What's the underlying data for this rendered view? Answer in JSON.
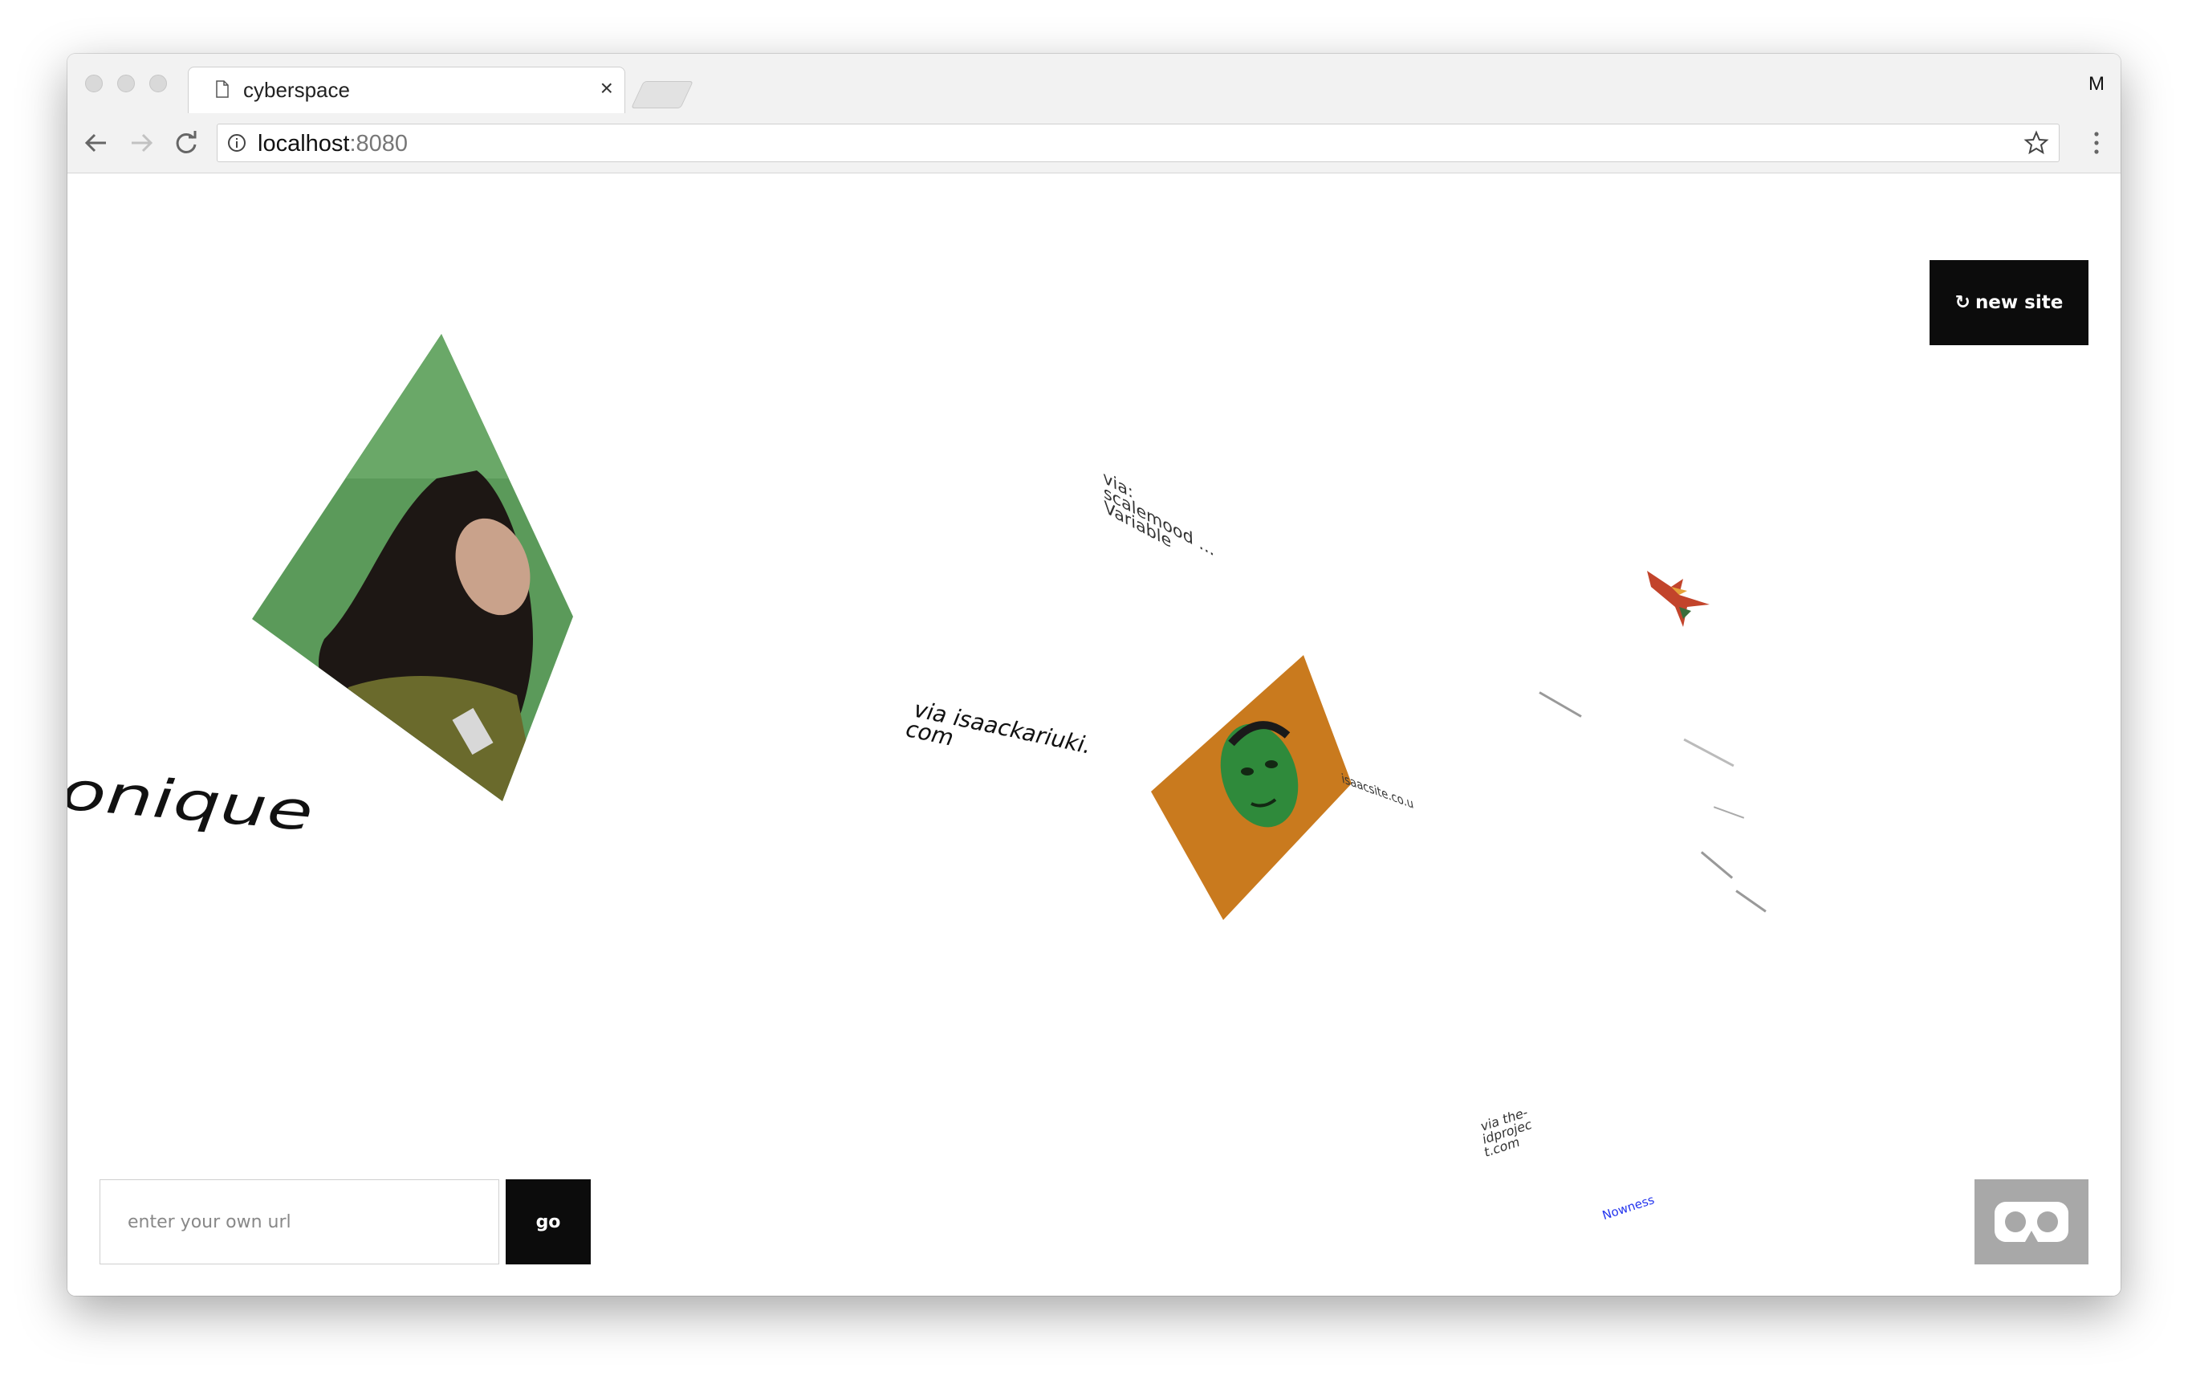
{
  "browser": {
    "tab_title": "cyberspace",
    "profile_initial": "M",
    "url_host": "localhost",
    "url_port": ":8080"
  },
  "page": {
    "new_site_label": "new site",
    "url_placeholder": "enter your own url",
    "go_label": "go",
    "floating_texts": {
      "monique": "onique",
      "via_isaack": "via isaackariuki. com",
      "via_mood_variable": "via: scalemood ... Variable",
      "via_idproject": "via the-idprojec t.com",
      "nowness": "Nowness",
      "isaac_domain": "isaacsite.co.u"
    }
  },
  "colors": {
    "button_dark": "#0c0c0c",
    "vr_button": "#a8a8a8",
    "link_blue": "#2233ee",
    "green_bg": "#5f9e5f",
    "orange_bg": "#c97a1e"
  },
  "icons": {
    "tab": "page-icon",
    "close": "close-icon",
    "back": "arrow-left-icon",
    "forward": "arrow-right-icon",
    "reload": "reload-icon",
    "info": "info-icon",
    "star": "star-icon",
    "menu": "kebab-menu-icon",
    "new_site": "refresh-icon",
    "vr": "vr-goggles-icon"
  }
}
